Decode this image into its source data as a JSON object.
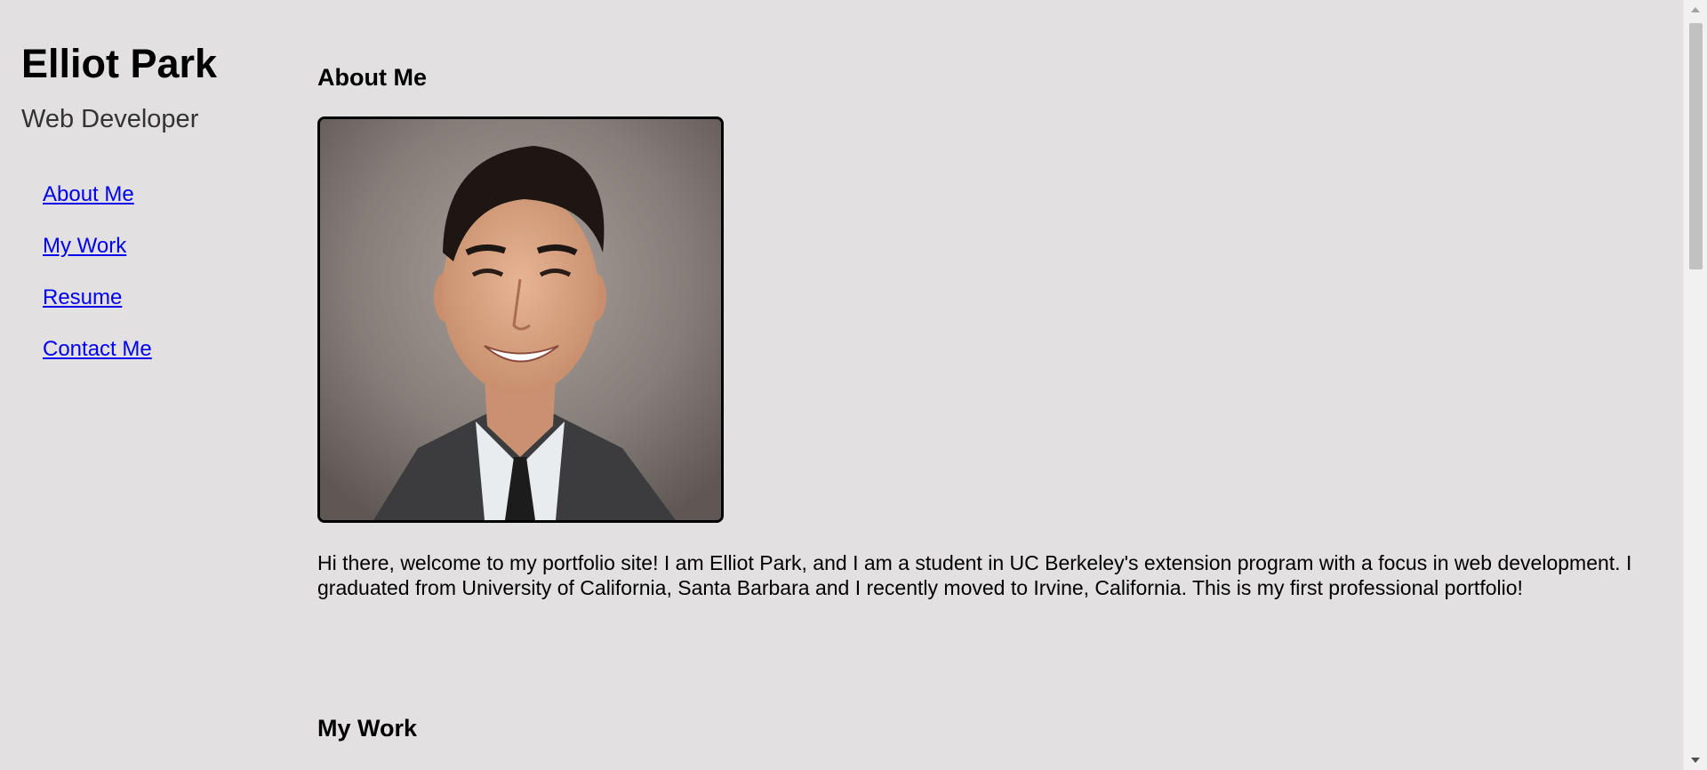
{
  "header": {
    "name": "Elliot Park",
    "role": "Web Developer"
  },
  "nav": {
    "items": [
      {
        "label": "About Me"
      },
      {
        "label": "My Work"
      },
      {
        "label": "Resume"
      },
      {
        "label": "Contact Me"
      }
    ]
  },
  "about": {
    "title": "About Me",
    "photo_alt": "Portrait photo",
    "bio": "Hi there, welcome to my portfolio site! I am Elliot Park, and I am a student in UC Berkeley's extension program with a focus in web development. I graduated from University of California, Santa Barbara and I recently moved to Irvine, California. This is my first professional portfolio!"
  },
  "work": {
    "title": "My Work"
  },
  "colors": {
    "background": "#e2e0e1",
    "link": "#0000ee"
  }
}
